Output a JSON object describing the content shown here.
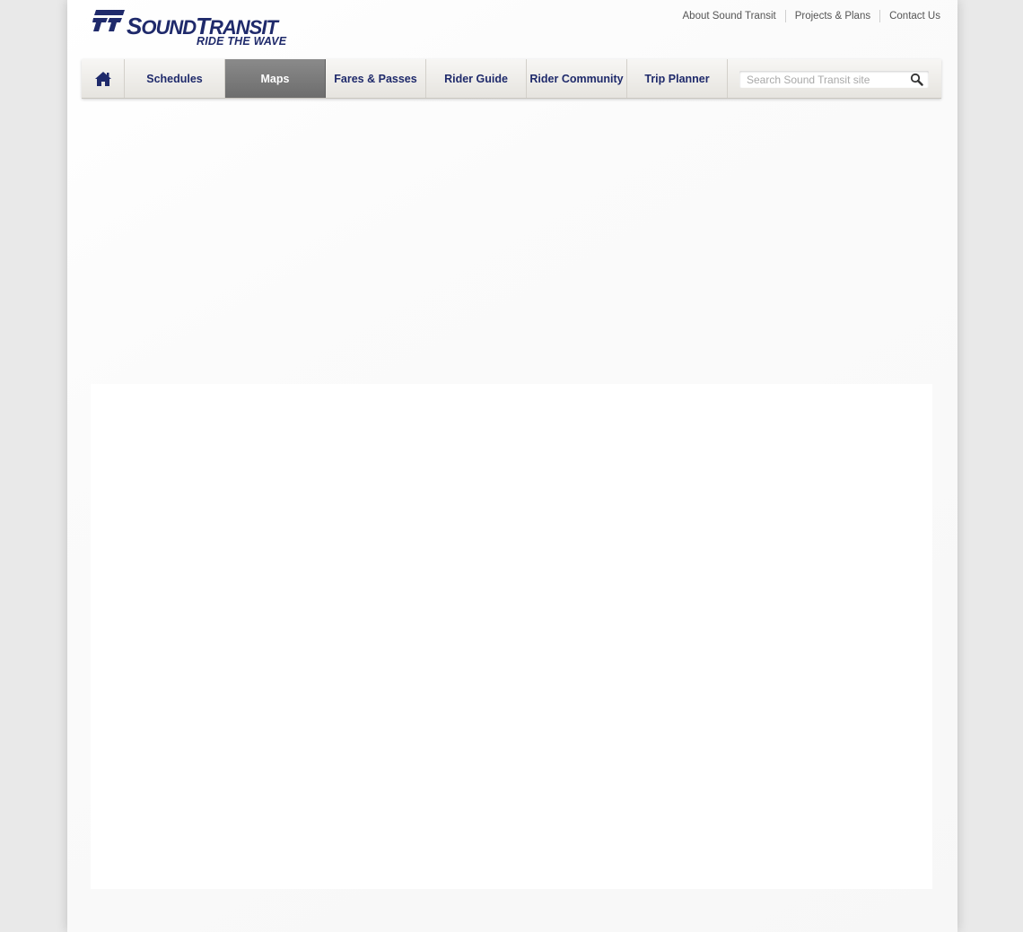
{
  "brand": {
    "name_prefix": "S",
    "name_rest": "OUND",
    "name_prefix2": "T",
    "name_rest2": "RANSIT",
    "tagline": "RIDE THE WAVE",
    "color": "#1f2a6b"
  },
  "utility_links": [
    "About Sound Transit",
    "Projects & Plans",
    "Contact Us"
  ],
  "nav": {
    "home_icon": "home-icon",
    "items": [
      {
        "label": "Schedules",
        "active": false
      },
      {
        "label": "Maps",
        "active": true
      },
      {
        "label": "Fares & Passes",
        "active": false
      },
      {
        "label": "Rider Guide",
        "active": false
      },
      {
        "label": "Rider Community",
        "active": false
      },
      {
        "label": "Trip Planner",
        "active": false
      }
    ]
  },
  "search": {
    "placeholder": "Search Sound Transit site",
    "value": "",
    "icon": "magnifier-icon"
  },
  "colors": {
    "accent": "#1f2a6b",
    "active_tab": "#767676",
    "background": "#e9e9e9"
  }
}
